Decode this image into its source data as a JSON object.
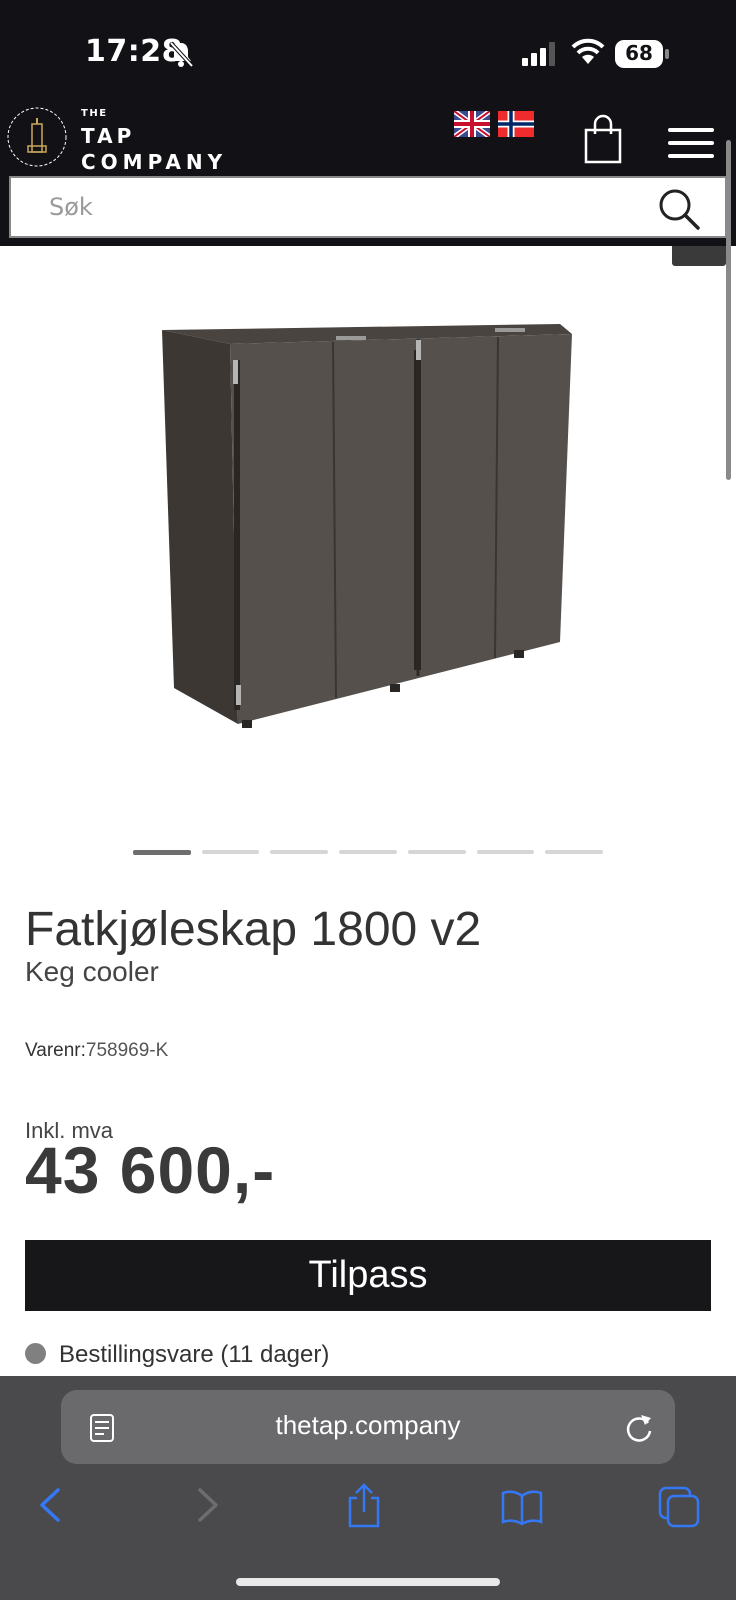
{
  "status_bar": {
    "time": "17:28",
    "battery": "68"
  },
  "header": {
    "logo_the": "THE",
    "logo_tap": "TAP",
    "logo_company": "COMPANY",
    "search_placeholder": "Søk"
  },
  "product": {
    "title": "Fatkjøleskap 1800 v2",
    "subtitle": "Keg cooler",
    "sku_label": "Varenr:",
    "sku_value": "758969-K",
    "vat_label": "Inkl. mva",
    "price": "43 600,-",
    "customize_label": "Tilpass",
    "stock_status": "Bestillingsvare (11 dager)",
    "stock_color": "#808080",
    "image_count": 7,
    "active_image": 1
  },
  "browser": {
    "url": "thetap.company"
  },
  "colors": {
    "header_bg": "#121216",
    "button_bg": "#17171a",
    "browser_bg": "#4a4a4c",
    "accent_blue": "#3478f6"
  }
}
